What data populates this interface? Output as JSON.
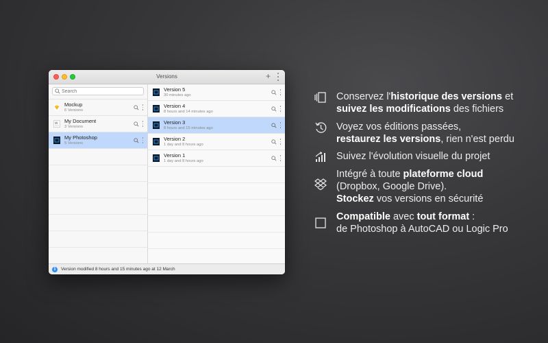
{
  "window": {
    "title": "Versions",
    "add_label": "+",
    "search_placeholder": "Search",
    "colors": {
      "selection": "#bfd8fb",
      "close": "#fc5f57",
      "minimize": "#fdbc2e",
      "maximize": "#28c840"
    }
  },
  "files": [
    {
      "name": "Mockup",
      "count": "6 Versions",
      "icon": "sketch-file-icon"
    },
    {
      "name": "My Document",
      "count": "3 Versions",
      "icon": "text-file-icon"
    },
    {
      "name": "My Photoshop",
      "count": "5 Versions",
      "icon": "photoshop-file-icon",
      "selected": true
    }
  ],
  "versions": [
    {
      "name": "Version 5",
      "time": "30 minutes ago"
    },
    {
      "name": "Version 4",
      "time": "8 hours and 14 minutes ago"
    },
    {
      "name": "Version 3",
      "time": "8 hours and 15 minutes ago",
      "selected": true
    },
    {
      "name": "Version 2",
      "time": "1 day and 8 hours ago"
    },
    {
      "name": "Version 1",
      "time": "1 day and 8 hours ago"
    }
  ],
  "status": {
    "text": "Version modified 8 hours and 15 minutes ago at 12 March",
    "info": "i"
  },
  "features": {
    "history": {
      "p1": "Conservez l'",
      "b1": "historique des versions",
      "p2": " et",
      "b2": "suivez les modifications",
      "p3": " des fichiers"
    },
    "restore": {
      "p1": "Voyez vos éditions passées,",
      "b1": "restaurez les versions",
      "p2": ", rien n'est perdu"
    },
    "visual": {
      "p1": "Suivez l'évolution visuelle du projet"
    },
    "cloud": {
      "p1": "Intégré à toute ",
      "b1": "plateforme cloud",
      "p2": "(Dropbox, Google Drive).",
      "b2": "Stockez",
      "p3": " vos versions en sécurité"
    },
    "format": {
      "b1": "Compatible",
      "p1": " avec ",
      "b2": "tout format",
      "p2": " :",
      "p3": "de Photoshop à AutoCAD ou Logic Pro"
    }
  }
}
